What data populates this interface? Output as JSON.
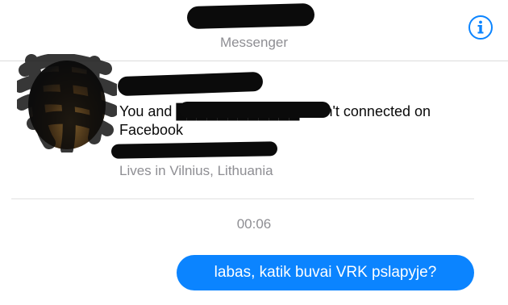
{
  "header": {
    "title": "",
    "subtitle": "Messenger",
    "info_icon": "info-circle-icon",
    "accent_color": "#0b84ff"
  },
  "profile": {
    "bio_text": "You and ████████████ aren't connected on Facebook",
    "lives_in": "Lives in Vilnius, Lithuania"
  },
  "conversation": {
    "timestamp": "00:06",
    "messages": [
      {
        "from": "me",
        "text": "labas, katik buvai VRK pslapyje?"
      }
    ]
  }
}
